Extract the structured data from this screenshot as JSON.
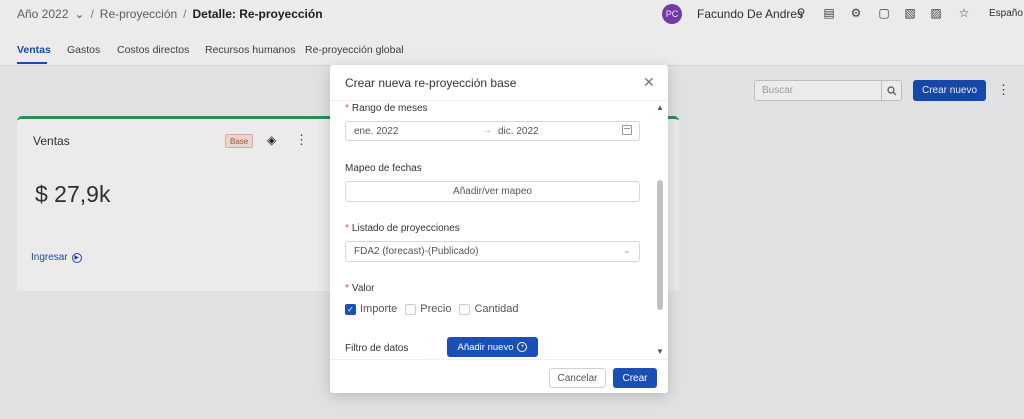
{
  "breadcrumb": {
    "year": "Año 2022",
    "section": "Re-proyección",
    "current": "Detalle: Re-proyección",
    "sep": "/"
  },
  "user": {
    "initials": "PC",
    "name": "Facundo De Andres",
    "avatar_color": "#7b3fb5"
  },
  "language": "Españo",
  "tabs": [
    {
      "label": "Ventas",
      "active": true
    },
    {
      "label": "Gastos"
    },
    {
      "label": "Costos directos"
    },
    {
      "label": "Recursos humanos"
    },
    {
      "label": "Re-proyección global"
    }
  ],
  "toolbar": {
    "search_placeholder": "Buscar",
    "create_label": "Crear nuevo"
  },
  "card": {
    "title": "Ventas",
    "badge": "Base",
    "amount": "$ 27,9k",
    "link": "Ingresar"
  },
  "modal": {
    "title": "Crear nueva re-proyección base",
    "range_label": "Rango de meses",
    "range_start": "ene. 2022",
    "range_end": "dic. 2022",
    "mapping_label": "Mapeo de fechas",
    "mapping_button": "Añadir/ver mapeo",
    "list_label": "Listado de proyecciones",
    "list_value": "FDA2 (forecast)-(Publicado)",
    "value_label": "Valor",
    "options": [
      {
        "label": "Importe",
        "checked": true
      },
      {
        "label": "Precio",
        "checked": false
      },
      {
        "label": "Cantidad",
        "checked": false
      }
    ],
    "filter_label": "Filtro de datos",
    "add_button": "Añadir nuevo",
    "cancel": "Cancelar",
    "create": "Crear"
  },
  "colors": {
    "primary": "#1a4fb8",
    "card_accent": "#2e9b5b",
    "required": "#e0483a"
  }
}
